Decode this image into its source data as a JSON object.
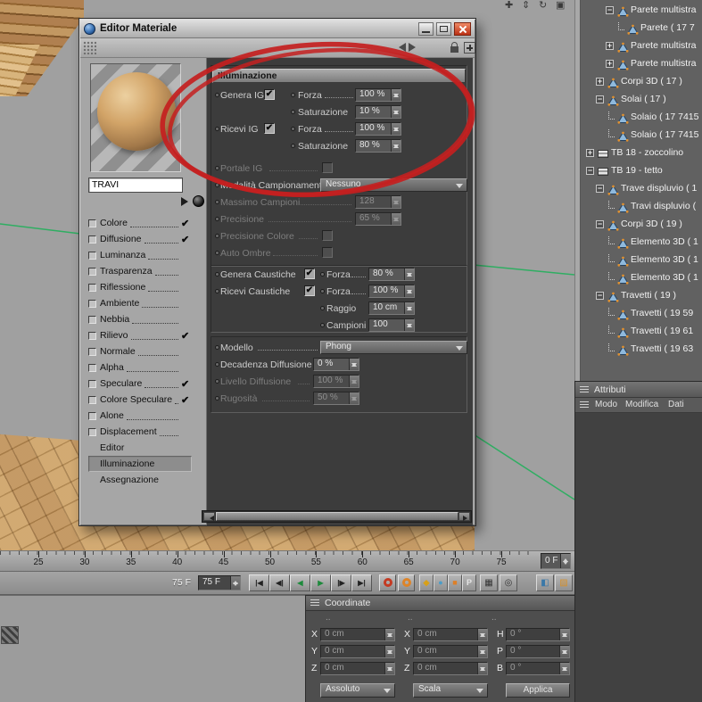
{
  "window": {
    "title": "Editor Materiale"
  },
  "glyphs": {
    "check": "✔"
  },
  "colors": {
    "annotation": "#c42020",
    "viewport_line": "#2fae62"
  },
  "viewport": {
    "icons": [
      {
        "name": "camera-pan-icon",
        "glyph": "✚"
      },
      {
        "name": "camera-zoom-icon",
        "glyph": "⇕"
      },
      {
        "name": "camera-rotate-icon",
        "glyph": "↻"
      },
      {
        "name": "toggle-view-icon",
        "glyph": "▣"
      }
    ]
  },
  "dialog": {
    "material_name": "TRAVI",
    "channels": [
      {
        "label": "Colore",
        "checked": true
      },
      {
        "label": "Diffusione",
        "checked": true
      },
      {
        "label": "Luminanza",
        "checked": false
      },
      {
        "label": "Trasparenza",
        "checked": false
      },
      {
        "label": "Riflessione",
        "checked": false
      },
      {
        "label": "Ambiente",
        "checked": false
      },
      {
        "label": "Nebbia",
        "checked": false
      },
      {
        "label": "Rilievo",
        "checked": true
      },
      {
        "label": "Normale",
        "checked": false
      },
      {
        "label": "Alpha",
        "checked": false
      },
      {
        "label": "Speculare",
        "checked": true
      },
      {
        "label": "Colore Speculare",
        "checked": true
      },
      {
        "label": "Alone",
        "checked": false
      },
      {
        "label": "Displacement",
        "checked": false
      }
    ],
    "pages": [
      {
        "label": "Editor",
        "active": false
      },
      {
        "label": "Illuminazione",
        "active": true
      },
      {
        "label": "Assegnazione",
        "active": false
      }
    ],
    "params": {
      "section_title": "Illuminazione",
      "genera_ig": "Genera IG",
      "forza_label": "Forza",
      "forza_ig_gen": "100 %",
      "saturazione_label": "Saturazione",
      "saturazione_gen": "10 %",
      "ricevi_ig": "Ricevi IG",
      "forza_ig_ric": "100 %",
      "saturazione_ric": "80 %",
      "portale_ig": "Portale IG",
      "modalita_label": "Modalità Campionamento",
      "modalita_value": "Nessuno",
      "massimo_label": "Massimo Campioni",
      "massimo_value": "128",
      "precisione_label": "Precisione",
      "precisione_value": "65 %",
      "precisione_colore_label": "Precisione Colore",
      "auto_ombre_label": "Auto Ombre",
      "genera_caustiche": "Genera Caustiche",
      "caustiche_forza_label": "Forza",
      "caustiche_gen_value": "80 %",
      "ricevi_caustiche": "Ricevi Caustiche",
      "caustiche_ric_value": "100 %",
      "raggio_label": "Raggio",
      "raggio_value": "10 cm",
      "campioni_label": "Campioni",
      "campioni_value": "100",
      "modello_label": "Modello",
      "modello_value": "Phong",
      "decadenza_label": "Decadenza Diffusione",
      "decadenza_value": "0 %",
      "livello_label": "Livello Diffusione",
      "livello_value": "100 %",
      "rugosita_label": "Rugosità",
      "rugosita_value": "50 %"
    }
  },
  "object_manager": {
    "items": [
      {
        "label": "Parete multistra",
        "depth": 2,
        "state": "expanded",
        "icon": "poly"
      },
      {
        "label": "Parete ( 17 7",
        "depth": 3,
        "state": null,
        "icon": "poly",
        "conn": true
      },
      {
        "label": "Parete multistra",
        "depth": 2,
        "state": "collapsed",
        "icon": "poly"
      },
      {
        "label": "Parete multistra",
        "depth": 2,
        "state": "collapsed",
        "icon": "poly"
      },
      {
        "label": "Corpi 3D ( 17 )",
        "depth": 1,
        "state": "collapsed",
        "icon": "poly"
      },
      {
        "label": "Solai ( 17 )",
        "depth": 1,
        "state": "expanded",
        "icon": "poly"
      },
      {
        "label": "Solaio ( 17 7415",
        "depth": 2,
        "state": null,
        "icon": "poly",
        "conn": true
      },
      {
        "label": "Solaio ( 17 7415",
        "depth": 2,
        "state": null,
        "icon": "poly",
        "conn": true
      },
      {
        "label": "TB 18 - zoccolino",
        "depth": 0,
        "state": "collapsed",
        "icon": "layer"
      },
      {
        "label": "TB 19 - tetto",
        "depth": 0,
        "state": "expanded",
        "icon": "layer"
      },
      {
        "label": "Trave displuvio ( 1",
        "depth": 1,
        "state": "expanded",
        "icon": "poly"
      },
      {
        "label": "Travi displuvio (",
        "depth": 2,
        "state": null,
        "icon": "poly",
        "conn": true
      },
      {
        "label": "Corpi 3D ( 19 )",
        "depth": 1,
        "state": "expanded",
        "icon": "poly"
      },
      {
        "label": "Elemento 3D ( 1",
        "depth": 2,
        "state": null,
        "icon": "poly",
        "conn": true
      },
      {
        "label": "Elemento 3D ( 1",
        "depth": 2,
        "state": null,
        "icon": "poly",
        "conn": true
      },
      {
        "label": "Elemento 3D ( 1",
        "depth": 2,
        "state": null,
        "icon": "poly",
        "conn": true
      },
      {
        "label": "Travetti ( 19 )",
        "depth": 1,
        "state": "expanded",
        "icon": "poly"
      },
      {
        "label": "Travetti ( 19 59",
        "depth": 2,
        "state": null,
        "icon": "poly",
        "conn": true
      },
      {
        "label": "Travetti ( 19 61",
        "depth": 2,
        "state": null,
        "icon": "poly",
        "conn": true
      },
      {
        "label": "Travetti ( 19 63",
        "depth": 2,
        "state": null,
        "icon": "poly",
        "conn": true
      }
    ]
  },
  "attribute_manager": {
    "title": "Attributi",
    "menu": [
      "Modo",
      "Modifica",
      "Dati"
    ]
  },
  "timeline": {
    "labels": [
      25,
      30,
      35,
      40,
      45,
      50,
      55,
      60,
      65,
      70,
      75
    ],
    "end_value": "0 F"
  },
  "transport": {
    "display_value": "75 F",
    "field_value": "75 F",
    "buttons": [
      {
        "name": "goto-start-button",
        "glyph": "|◀",
        "color": "#222222"
      },
      {
        "name": "prev-key-button",
        "glyph": "◀|",
        "color": "#222222"
      },
      {
        "name": "play-backward-button",
        "glyph": "◀",
        "color": "#1e8a3c"
      },
      {
        "name": "play-forward-button",
        "glyph": "▶",
        "color": "#1e8a3c"
      },
      {
        "name": "next-key-button",
        "glyph": "|▶",
        "color": "#222222"
      },
      {
        "name": "goto-end-button",
        "glyph": "▶|",
        "color": "#222222"
      }
    ],
    "record_buttons": [
      {
        "name": "record-keyframe-button",
        "color": "#c43a22"
      },
      {
        "name": "autokey-button",
        "color": "#de8428"
      }
    ],
    "key_toggles": [
      {
        "name": "record-position-toggle",
        "glyph": "◆",
        "color": "#d8a018"
      },
      {
        "name": "record-scale-toggle",
        "glyph": "●",
        "color": "#4a9cc8"
      },
      {
        "name": "record-rotation-toggle",
        "glyph": "■",
        "color": "#dd7f28"
      },
      {
        "name": "record-parameter-toggle",
        "glyph": "P",
        "color": "#e6e6e6"
      }
    ],
    "extra_buttons": [
      {
        "name": "snap-settings-button",
        "glyph": "▦",
        "color": "#333333"
      },
      {
        "name": "pla-toggle-button",
        "glyph": "◎",
        "color": "#333333"
      },
      {
        "name": "timeline-option-button-1",
        "glyph": "◧",
        "color": "#3a78a8"
      },
      {
        "name": "timeline-option-button-2",
        "glyph": "▨",
        "color": "#d89028"
      }
    ]
  },
  "coordinates": {
    "title": "Coordinate",
    "col_dividers": [
      "..",
      "..",
      ".."
    ],
    "rows": [
      {
        "l1": "X",
        "v1": "0 cm",
        "l2": "X",
        "v2": "0 cm",
        "l3": "H",
        "v3": "0 °"
      },
      {
        "l1": "Y",
        "v1": "0 cm",
        "l2": "Y",
        "v2": "0 cm",
        "l3": "P",
        "v3": "0 °"
      },
      {
        "l1": "Z",
        "v1": "0 cm",
        "l2": "Z",
        "v2": "0 cm",
        "l3": "B",
        "v3": "0 °"
      }
    ],
    "mode_dropdown": "Assoluto",
    "scale_dropdown": "Scala",
    "apply_button": "Applica"
  }
}
